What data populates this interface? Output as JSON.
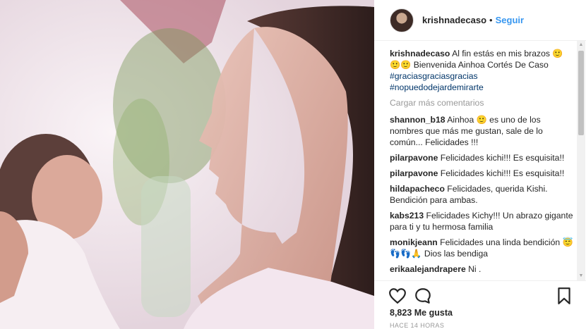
{
  "post": {
    "username": "krishnadecaso",
    "follow_label": "Seguir",
    "separator": "•",
    "caption": {
      "username": "krishnadecaso",
      "text": "Al fin estás en mis brazos 🙂 🙂🙂 Bienvenida Ainhoa Cortés De Caso",
      "hashtags": [
        "#graciasgraciasgracias",
        "#nopuedodejardemirarte"
      ]
    },
    "load_more_label": "Cargar más comentarios",
    "comments": [
      {
        "user": "shannon_b18",
        "text": "Ainhoa 🙂 es uno de los nombres que más me gustan, sale de lo común... Felicidades !!!"
      },
      {
        "user": "pilarpavone",
        "text": "Felicidades kichi!!! Es esquisita!!"
      },
      {
        "user": "pilarpavone",
        "text": "Felicidades kichi!!! Es esquisita!!"
      },
      {
        "user": "hildapacheco",
        "text": "Felicidades, querida Kishi. Bendición para ambas."
      },
      {
        "user": "kabs213",
        "text": "Felicidades Kichy!!! Un abrazo gigante para ti y tu hermosa familia"
      },
      {
        "user": "monikjeann",
        "text": "Felicidades una linda bendición 😇👣👣🙏 Dios las bendiga"
      },
      {
        "user": "erikaalejandrapere",
        "text": "Ni ."
      }
    ],
    "likes_label": "8,823 Me gusta",
    "time_label": "HACE 14 HORAS"
  },
  "icons": {
    "like": "heart-icon",
    "comment": "comment-icon",
    "save": "bookmark-icon",
    "scroll_up": "▲",
    "scroll_down": "▼"
  },
  "colors": {
    "link_blue": "#3897f0",
    "hashtag": "#003569",
    "muted": "#999999"
  }
}
